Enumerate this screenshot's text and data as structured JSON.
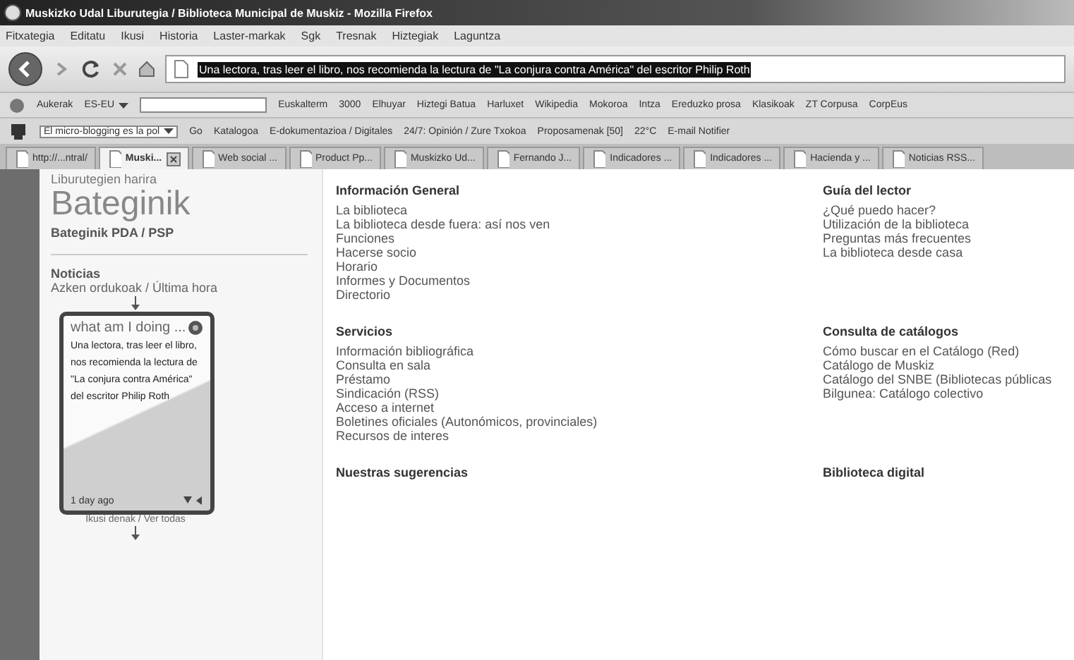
{
  "window": {
    "title": "Muskizko Udal Liburutegia / Biblioteca Municipal de Muskiz - Mozilla Firefox"
  },
  "menu": [
    "Fitxategia",
    "Editatu",
    "Ikusi",
    "Historia",
    "Laster-markak",
    "Sgk",
    "Tresnak",
    "Hiztegiak",
    "Laguntza"
  ],
  "address_bar": {
    "value": "Una lectora, tras leer el libro, nos recomienda la lectura de \"La conjura contra América\" del escritor Philip Roth"
  },
  "dictionary_toolbar": {
    "options": "Aukerak",
    "language": "ES-EU",
    "links": [
      "Euskalterm",
      "3000",
      "Elhuyar",
      "Hiztegi Batua",
      "Harluxet",
      "Wikipedia",
      "Mokoroa",
      "Intza",
      "Ereduzko prosa",
      "Klasikoak",
      "ZT Corpusa",
      "CorpEus"
    ]
  },
  "bookmarks_toolbar": {
    "feed": "El micro-blogging es la pol",
    "items": [
      "Go",
      "Katalogoa",
      "E-dokumentazioa / Digitales",
      "24/7: Opinión / Zure Txokoa",
      "Proposamenak [50]",
      "22°C",
      "E-mail Notifier"
    ]
  },
  "tabs": [
    {
      "label": "http://...ntral/",
      "selected": false
    },
    {
      "label": "Muski...",
      "selected": true
    },
    {
      "label": "Web social ...",
      "selected": false
    },
    {
      "label": "Product Pp...",
      "selected": false
    },
    {
      "label": "Muskizko Ud...",
      "selected": false
    },
    {
      "label": "Fernando J...",
      "selected": false
    },
    {
      "label": "Indicadores ...",
      "selected": false
    },
    {
      "label": "Indicadores ...",
      "selected": false
    },
    {
      "label": "Hacienda y ...",
      "selected": false
    },
    {
      "label": "Noticias RSS...",
      "selected": false
    }
  ],
  "sidebar": {
    "tagline": "Liburutegien harira",
    "logo": "Bateginik",
    "pda_link": "Bateginik PDA / PSP",
    "news_title": "Noticias",
    "news_subtitle": "Azken ordukoak / Última hora",
    "widget": {
      "title": "what am I doing ...",
      "text": "Una lectora, tras leer el libro, nos recomienda la lectura de \"La conjura contra América\" del escritor Philip Roth",
      "time": "1 day ago"
    },
    "see_all": "Ikusi denak / Ver todas"
  },
  "sections": [
    {
      "title": "Información General",
      "links": [
        "La biblioteca",
        "La biblioteca desde fuera: así nos ven",
        "Funciones",
        "Hacerse socio",
        "Horario",
        "Informes y Documentos",
        "Directorio"
      ]
    },
    {
      "title": "Guía del lector",
      "links": [
        "¿Qué puedo hacer?",
        "Utilización de la biblioteca",
        "Preguntas más frecuentes",
        "La biblioteca desde casa"
      ]
    },
    {
      "title": "Servicios",
      "links": [
        "Información bibliográfica",
        "Consulta en sala",
        "Préstamo",
        "Sindicación (RSS)",
        "Acceso a internet",
        "Boletines oficiales (Autonómicos, provinciales)",
        "Recursos de interes"
      ]
    },
    {
      "title": "Consulta de catálogos",
      "links": [
        "Cómo buscar en el Catálogo (Red)",
        "Catálogo de Muskiz",
        "Catálogo del SNBE (Bibliotecas públicas",
        "Bilgunea: Catálogo colectivo"
      ]
    },
    {
      "title": "Nuestras sugerencias"
    },
    {
      "title": "Biblioteca digital"
    }
  ]
}
